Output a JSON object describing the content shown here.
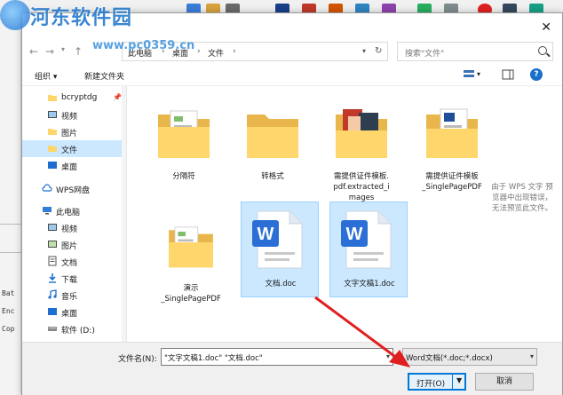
{
  "watermark": {
    "title": "河东软件园",
    "url": "www.pc0359.cn"
  },
  "address_bar": {
    "segments": [
      "此电脑",
      "桌面",
      "文件"
    ],
    "search_placeholder": "搜索\"文件\""
  },
  "toolbar": {
    "organize_label": "组织 ▾",
    "new_folder_label": "新建文件夹"
  },
  "sidebar": {
    "items": [
      {
        "label": "bcryptdg",
        "icon": "folder-icon"
      },
      {
        "label": "视频",
        "icon": "video-icon"
      },
      {
        "label": "图片",
        "icon": "picture-icon"
      },
      {
        "label": "文件",
        "icon": "folder-icon"
      },
      {
        "label": "桌面",
        "icon": "desktop-icon"
      },
      {
        "label": "WPS网盘",
        "icon": "cloud-icon"
      },
      {
        "label": "此电脑",
        "icon": "computer-icon"
      },
      {
        "label": "视频",
        "icon": "video-icon"
      },
      {
        "label": "图片",
        "icon": "picture-icon"
      },
      {
        "label": "文档",
        "icon": "document-icon"
      },
      {
        "label": "下载",
        "icon": "download-icon"
      },
      {
        "label": "音乐",
        "icon": "music-icon"
      },
      {
        "label": "桌面",
        "icon": "desktop-icon"
      },
      {
        "label": "软件 (D:)",
        "icon": "drive-icon"
      }
    ]
  },
  "files": [
    {
      "name": "分隔符",
      "type": "folder"
    },
    {
      "name": "转格式",
      "type": "folder"
    },
    {
      "name": "需提供证件模板.pdf.extracted_images",
      "lines": [
        "需提供证件模板.",
        "pdf.extracted_i",
        "mages"
      ],
      "type": "folder"
    },
    {
      "name": "需提供证件模板_SinglePagePDF",
      "lines": [
        "需提供证件模板",
        "_SinglePagePDF"
      ],
      "type": "folder"
    },
    {
      "name": "演示_SinglePagePDF",
      "lines": [
        "演示",
        "_SinglePagePDF"
      ],
      "type": "folder"
    },
    {
      "name": "文档.doc",
      "type": "doc"
    },
    {
      "name": "文字文稿1.doc",
      "type": "doc"
    }
  ],
  "preview_message": "由于 WPS 文字 预览器中出现错误，无法预览此文件。",
  "bottom": {
    "filename_label": "文件名(N):",
    "filename_value": "\"文字文稿1.doc\" \"文档.doc\"",
    "filter_value": "Word文档(*.doc;*.docx)",
    "open_label": "打开(O)",
    "cancel_label": "取消"
  },
  "background_left_text": [
    "Bat",
    "Enc",
    "Cop"
  ],
  "colors": {
    "accent": "#0078d7",
    "selection": "#cce8ff",
    "folder": "#ffd66b",
    "doc_blue": "#2b6fd6",
    "arrow_red": "#e02020"
  }
}
